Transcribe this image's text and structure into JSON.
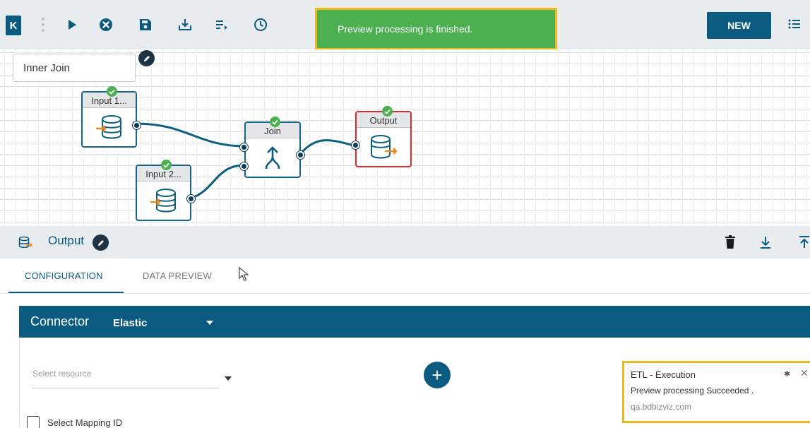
{
  "toolbar": {
    "brand_glyph": "K",
    "icons": [
      "play-icon",
      "cancel-circle-icon",
      "save-icon",
      "download-tray-icon",
      "list-arrow-icon",
      "clock-icon"
    ],
    "new_label": "NEW",
    "menu_icon": "hamburger-list-icon"
  },
  "toast": {
    "message": "Preview processing is finished."
  },
  "canvas": {
    "name_field": "Inner Join",
    "nodes": [
      {
        "id": "input1",
        "label": "Input 1...",
        "status": "success"
      },
      {
        "id": "input2",
        "label": "Input 2...",
        "status": "success"
      },
      {
        "id": "join",
        "label": "Join",
        "status": "success"
      },
      {
        "id": "output",
        "label": "Output",
        "status": "success",
        "selected": true
      }
    ]
  },
  "panel": {
    "title": "Output",
    "actions": [
      "trash-icon",
      "download-icon",
      "upload-icon"
    ]
  },
  "tabs": [
    {
      "label": "CONFIGURATION",
      "active": true
    },
    {
      "label": "DATA PREVIEW",
      "active": false
    }
  ],
  "connector": {
    "label": "Connector",
    "value": "Elastic",
    "resource_placeholder": "Select resource",
    "add_glyph": "+",
    "checkbox_label": "Select Mapping ID"
  },
  "notification": {
    "title": "ETL - Execution",
    "message": "Preview processing Succeeded .",
    "source": "qa.bdbizviz.com"
  },
  "colors": {
    "primary": "#0b5a80",
    "toast_bg": "#4caf50",
    "highlight_border": "#f0b81e",
    "output_border": "#e02a2a",
    "status_success": "#4caf50"
  }
}
